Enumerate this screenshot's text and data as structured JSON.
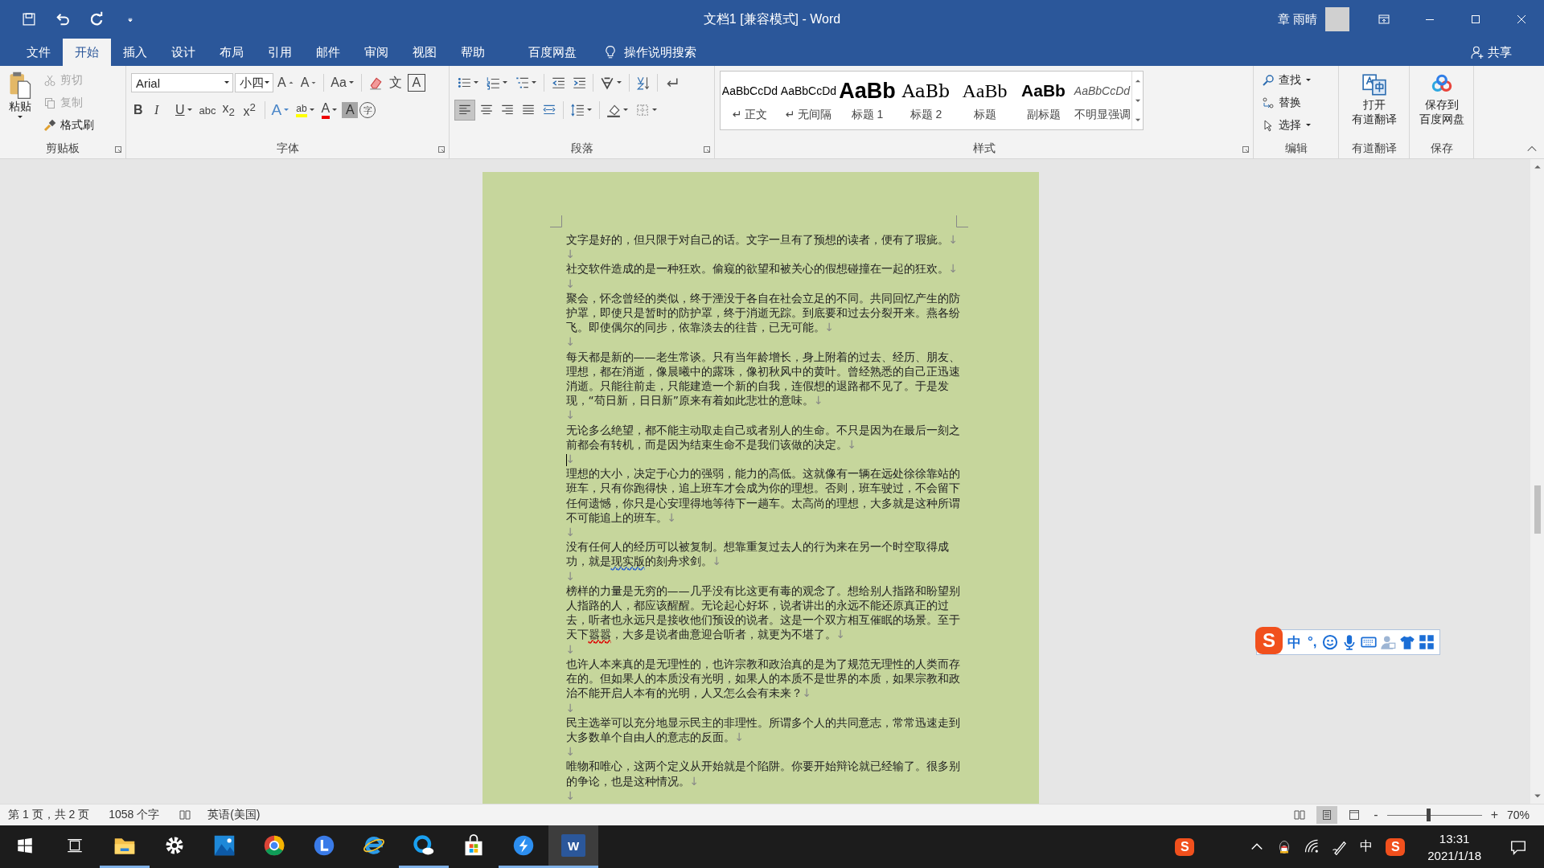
{
  "window": {
    "title": "文档1 [兼容模式] - Word",
    "user": "章 雨晴"
  },
  "quick_access": [
    {
      "kind": "save"
    },
    {
      "kind": "undo"
    },
    {
      "kind": "redo"
    },
    {
      "kind": "customize"
    }
  ],
  "tabs": [
    {
      "label": "文件",
      "selected": false
    },
    {
      "label": "开始",
      "selected": true
    },
    {
      "label": "插入",
      "selected": false
    },
    {
      "label": "设计",
      "selected": false
    },
    {
      "label": "布局",
      "selected": false
    },
    {
      "label": "引用",
      "selected": false
    },
    {
      "label": "邮件",
      "selected": false
    },
    {
      "label": "审阅",
      "selected": false
    },
    {
      "label": "视图",
      "selected": false
    },
    {
      "label": "帮助",
      "selected": false
    },
    {
      "label": "百度网盘",
      "selected": false
    }
  ],
  "tell_me": "操作说明搜索",
  "share": "共享",
  "clipboard": {
    "title": "剪贴板",
    "paste": "粘贴",
    "items": [
      {
        "kind": "cut",
        "label": "剪切",
        "disabled": true
      },
      {
        "kind": "copy",
        "label": "复制",
        "disabled": true
      },
      {
        "kind": "painter",
        "label": "格式刷",
        "disabled": false
      }
    ]
  },
  "font": {
    "title": "字体",
    "font_name": "Arial",
    "font_size": "小四",
    "row1": [
      {
        "kind": "grow",
        "label": "A"
      },
      {
        "kind": "shrink",
        "label": "A"
      },
      {
        "kind": "case",
        "label": "Aa"
      },
      {
        "kind": "clear"
      },
      {
        "kind": "phonetic",
        "label": "文"
      },
      {
        "kind": "border",
        "label": "A"
      }
    ],
    "row2": [
      {
        "kind": "bold",
        "label": "B"
      },
      {
        "kind": "italic",
        "label": "I"
      },
      {
        "kind": "underline",
        "label": "U"
      },
      {
        "kind": "strike",
        "label": "abc"
      },
      {
        "kind": "sub",
        "label": "x$_{2}$"
      },
      {
        "kind": "sup",
        "label": "x$^{2}$"
      },
      {
        "kind": "effects",
        "label": "A"
      },
      {
        "kind": "highlight",
        "label": "ab"
      },
      {
        "kind": "color",
        "label": "A"
      },
      {
        "kind": "shading",
        "label": "A"
      },
      {
        "kind": "enclose",
        "label": "字"
      }
    ]
  },
  "paragraph": {
    "title": "段落",
    "row1": [
      {
        "kind": "bullets"
      },
      {
        "kind": "numbering"
      },
      {
        "kind": "multilevel"
      },
      {
        "kind": "outdent"
      },
      {
        "kind": "indent"
      },
      {
        "kind": "asian"
      },
      {
        "kind": "sort"
      },
      {
        "kind": "marks"
      }
    ],
    "row2": [
      {
        "kind": "left",
        "selected": true
      },
      {
        "kind": "center",
        "selected": false
      },
      {
        "kind": "right",
        "selected": false
      },
      {
        "kind": "justify",
        "selected": false
      },
      {
        "kind": "distribute",
        "selected": false
      },
      {
        "kind": "spacing",
        "selected": false
      },
      {
        "kind": "fill",
        "selected": false
      },
      {
        "kind": "borders",
        "selected": false
      }
    ]
  },
  "styles": {
    "title": "样式",
    "items": [
      {
        "kind": "normal",
        "sample": "AaBbCcDd",
        "label": "正文",
        "mark": "↵"
      },
      {
        "kind": "normal",
        "sample": "AaBbCcDd",
        "label": "无间隔",
        "mark": "↵"
      },
      {
        "kind": "heading1",
        "sample": "AaBb",
        "label": "标题 1"
      },
      {
        "kind": "heading2",
        "sample": "AaBb",
        "label": "标题 2"
      },
      {
        "kind": "title",
        "sample": "AaBb",
        "label": "标题"
      },
      {
        "kind": "subtitle",
        "sample": "AaBb",
        "label": "副标题"
      },
      {
        "kind": "emphasis",
        "sample": "AaBbCcDd",
        "label": "不明显强调"
      }
    ]
  },
  "editing": {
    "title": "编辑",
    "items": [
      {
        "kind": "find",
        "label": "查找"
      },
      {
        "kind": "replace",
        "label": "替换"
      },
      {
        "kind": "select",
        "label": "选择"
      }
    ]
  },
  "translate": {
    "title": "有道翻译",
    "button": [
      "打开",
      "有道翻译"
    ]
  },
  "save_group": {
    "title": "保存",
    "button": [
      "保存到",
      "百度网盘"
    ]
  },
  "document": {
    "paragraphs": [
      {
        "text": "文字是好的，但只限于对自己的话。文字一旦有了预想的读者，便有了瑕疵。",
        "mark": "↓",
        "cursor": false
      },
      {
        "mark": "↓",
        "cursor": false
      },
      {
        "text": "社交软件造成的是一种狂欢。偷窥的欲望和被关心的假想碰撞在一起的狂欢。",
        "mark": "↓",
        "cursor": false
      },
      {
        "mark": "↓",
        "cursor": false
      },
      {
        "text": "聚会，怀念曾经的类似，终于湮没于各自在社会立足的不同。共同回忆产生的防护罩，即使只是暂时的防护罩，终于消逝无踪。到底要和过去分裂开来。燕各纷飞。即使偶尔的同步，依靠淡去的往昔，已无可能。",
        "mark": "↓",
        "cursor": false
      },
      {
        "mark": "↓",
        "cursor": false
      },
      {
        "text": "每天都是新的——老生常谈。只有当年龄增长，身上附着的过去、经历、朋友、理想，都在消逝，像晨曦中的露珠，像初秋风中的黄叶。曾经熟悉的自己正迅速消逝。只能往前走，只能建造一个新的自我，连假想的退路都不见了。于是发现，“苟日新，日日新”原来有着如此悲壮的意味。",
        "mark": "↓",
        "cursor": false
      },
      {
        "mark": "↓",
        "cursor": false
      },
      {
        "text": "无论多么绝望，都不能主动取走自己或者别人的生命。不只是因为在最后一刻之前都会有转机，而是因为结束生命不是我们该做的决定。",
        "mark": "↓",
        "cursor": false
      },
      {
        "mark": "↓",
        "cursor": true
      },
      {
        "text": "理想的大小，决定于心力的强弱，能力的高低。这就像有一辆在远处徐徐靠站的班车，只有你跑得快，追上班车才会成为你的理想。否则，班车驶过，不会留下任何遗憾，你只是心安理得地等待下一趟车。太高尚的理想，大多就是这种所谓不可能追上的班车。",
        "mark": "↓",
        "cursor": false
      },
      {
        "mark": "↓",
        "cursor": false
      },
      {
        "runs": [
          {
            "text": "没有任何人的经历可以被复制。想靠重复过去人的行为来在另一个时空取得成功，就是"
          },
          {
            "text": "现实版",
            "grammar_error": true
          },
          {
            "text": "的刻舟求剑。"
          }
        ],
        "mark": "↓",
        "cursor": false
      },
      {
        "mark": "↓",
        "cursor": false
      },
      {
        "runs": [
          {
            "text": "榜样的力量是无穷的——几乎没有比这更有毒的观念了。想给别人指路和盼望别人指路的人，都应该醒醒。无论起心好坏，说者讲出的永远不能还原真正的过去，听者也永远只是接收他们预设的说者。这是一个双方相互催眠的场景。至于天下"
          },
          {
            "text": "嚣嚣",
            "spelling_error": true
          },
          {
            "text": "，大多是说者曲意迎合听者，就更为不堪了。"
          }
        ],
        "mark": "↓",
        "cursor": false
      },
      {
        "mark": "↓",
        "cursor": false
      },
      {
        "text": "也许人本来真的是无理性的，也许宗教和政治真的是为了规范无理性的人类而存在的。但如果人的本质没有光明，如果人的本质不是世界的本质，如果宗教和政治不能开启人本有的光明，人又怎么会有未来？",
        "mark": "↓",
        "cursor": false
      },
      {
        "mark": "↓",
        "cursor": false
      },
      {
        "text": "民主选举可以充分地显示民主的非理性。所谓多个人的共同意志，常常迅速走到大多数单个自由人的意志的反面。",
        "mark": "↓",
        "cursor": false
      },
      {
        "mark": "↓",
        "cursor": false
      },
      {
        "text": "唯物和唯心，这两个定义从开始就是个陷阱。你要开始辩论就已经输了。很多别的争论，也是这种情况。",
        "mark": "↓",
        "cursor": false
      },
      {
        "mark": "↓",
        "cursor": false
      }
    ]
  },
  "ime_bar": {
    "logo": "S",
    "items": [
      {
        "kind": "text",
        "label": "中"
      },
      {
        "kind": "text",
        "label": "°,"
      },
      {
        "kind": "smile"
      },
      {
        "kind": "mic"
      },
      {
        "kind": "keyboard"
      },
      {
        "kind": "user"
      },
      {
        "kind": "shirt"
      },
      {
        "kind": "grid"
      }
    ]
  },
  "status_bar": {
    "page": "第 1 页，共 2 页",
    "words": "1058 个字",
    "language": "英语(美国)",
    "views": [
      {
        "kind": "read",
        "selected": false
      },
      {
        "kind": "print",
        "selected": true
      },
      {
        "kind": "web",
        "selected": false
      }
    ],
    "zoom_out": "-",
    "zoom_in": "+",
    "zoom": {
      "level": 0.42
    },
    "zoom_label": "70%"
  },
  "taskbar": {
    "apps": [
      {
        "kind": "start",
        "running": false,
        "selected": false
      },
      {
        "kind": "taskview",
        "running": false,
        "selected": false
      },
      {
        "kind": "folder",
        "running": true,
        "selected": false
      },
      {
        "kind": "gear",
        "running": false,
        "selected": false
      },
      {
        "kind": "photos",
        "running": false,
        "selected": false
      },
      {
        "kind": "chrome",
        "running": false,
        "selected": false
      },
      {
        "kind": "lcircle",
        "running": false,
        "selected": false
      },
      {
        "kind": "ebrowser",
        "running": false,
        "selected": false
      },
      {
        "kind": "qcloud",
        "running": true,
        "selected": false
      },
      {
        "kind": "store",
        "running": false,
        "selected": false
      },
      {
        "kind": "bolt",
        "running": true,
        "selected": false
      },
      {
        "kind": "word",
        "label": "W",
        "running": true,
        "selected": true
      }
    ],
    "tray": [
      {
        "kind": "sogou",
        "label": "S"
      },
      {
        "kind": "chevron"
      },
      {
        "kind": "penguin"
      },
      {
        "kind": "wifi"
      },
      {
        "kind": "pen"
      },
      {
        "kind": "text",
        "label": "中"
      },
      {
        "kind": "sogou",
        "label": "S"
      }
    ],
    "time": "13:31",
    "date": "2021/1/18"
  }
}
